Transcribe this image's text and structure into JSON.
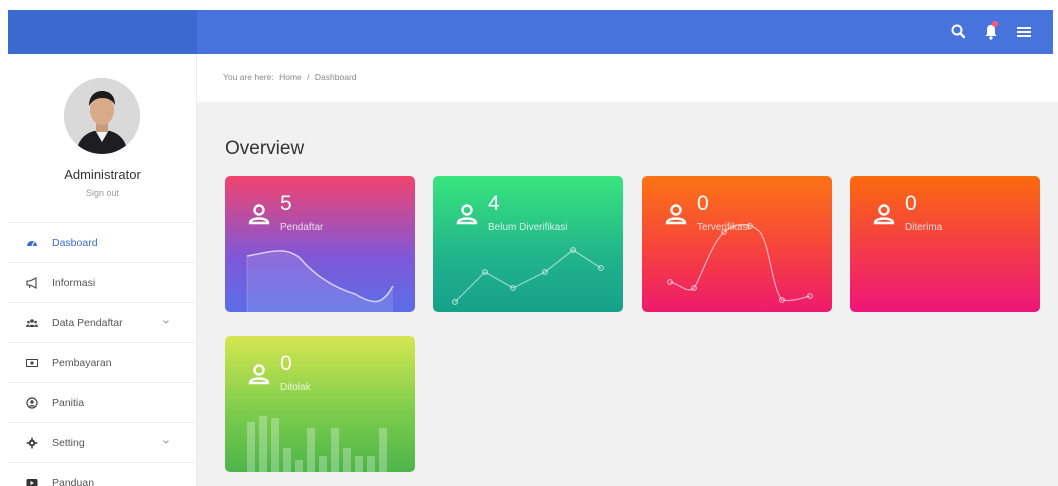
{
  "sidebar": {
    "admin_name": "Administrator",
    "signout": "Sign out",
    "items": [
      {
        "label": "Dasboard",
        "icon": "dashboard-icon",
        "active": true
      },
      {
        "label": "Informasi",
        "icon": "megaphone-icon"
      },
      {
        "label": "Data Pendaftar",
        "icon": "users-icon",
        "has_submenu": true
      },
      {
        "label": "Pembayaran",
        "icon": "money-icon"
      },
      {
        "label": "Panitia",
        "icon": "user-circle-icon"
      },
      {
        "label": "Setting",
        "icon": "gear-icon",
        "has_submenu": true
      },
      {
        "label": "Panduan",
        "icon": "video-icon"
      }
    ]
  },
  "breadcrumb": {
    "prefix": "You are here:",
    "home": "Home",
    "separator": "/",
    "current": "Dashboard"
  },
  "main": {
    "title": "Overview"
  },
  "cards": [
    {
      "value": "5",
      "label": "Pendaftar"
    },
    {
      "value": "4",
      "label": "Belum Diverifikasi"
    },
    {
      "value": "0",
      "label": "Terverifikasi"
    },
    {
      "value": "0",
      "label": "Diterima"
    },
    {
      "value": "0",
      "label": "Ditolak"
    }
  ],
  "colors": {
    "topbar": "#4674dc",
    "brand": "#3a6ad0",
    "notification_dot": "#ff5a6a"
  }
}
